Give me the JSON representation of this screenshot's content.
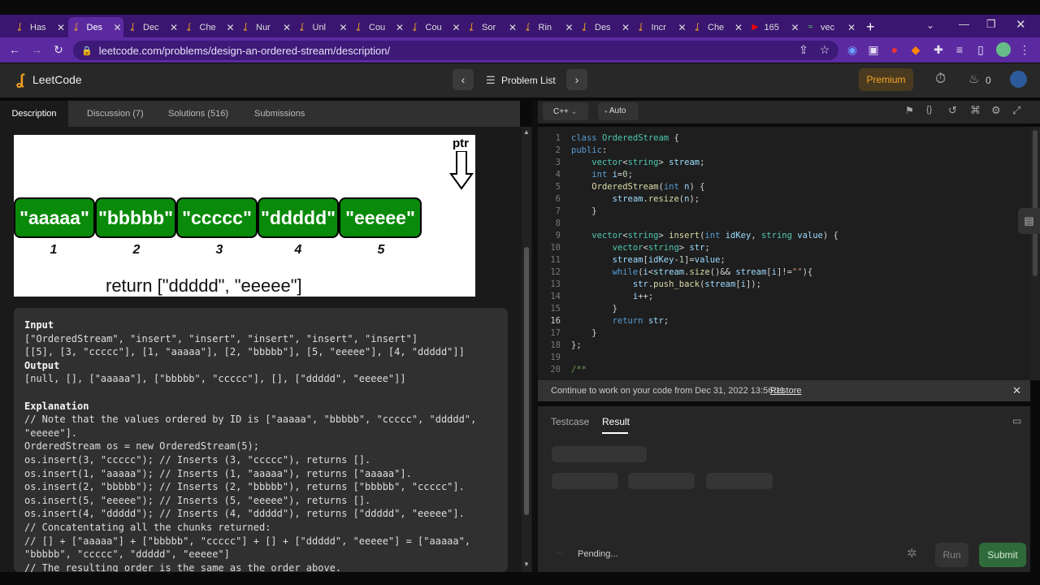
{
  "browser": {
    "tabs": [
      {
        "title": "Has",
        "active": false
      },
      {
        "title": "Des",
        "active": true
      },
      {
        "title": "Dec",
        "active": false
      },
      {
        "title": "Che",
        "active": false
      },
      {
        "title": "Nur",
        "active": false
      },
      {
        "title": "Unl",
        "active": false
      },
      {
        "title": "Cou",
        "active": false
      },
      {
        "title": "Cou",
        "active": false
      },
      {
        "title": "Sor",
        "active": false
      },
      {
        "title": "Rin",
        "active": false
      },
      {
        "title": "Des",
        "active": false
      },
      {
        "title": "Incr",
        "active": false
      },
      {
        "title": "Che",
        "active": false
      },
      {
        "title": "165",
        "active": false
      },
      {
        "title": "vec",
        "active": false
      }
    ],
    "url": "leetcode.com/problems/design-an-ordered-stream/description/"
  },
  "header": {
    "logo": "LeetCode",
    "problem_list": "Problem List",
    "premium": "Premium",
    "streak": "0"
  },
  "left_tabs": [
    "Description",
    "Discussion (7)",
    "Solutions (516)",
    "Submissions"
  ],
  "figure": {
    "ptr": "ptr",
    "blocks": [
      "\"aaaaa\"",
      "\"bbbbb\"",
      "\"ccccc\"",
      "\"ddddd\"",
      "\"eeeee\""
    ],
    "numbers": [
      "1",
      "2",
      "3",
      "4",
      "5"
    ],
    "return_text": "return [\"ddddd\", \"eeeee\"]"
  },
  "example": {
    "input_label": "Input",
    "input_lines": [
      "[\"OrderedStream\", \"insert\", \"insert\", \"insert\", \"insert\", \"insert\"]",
      "[[5], [3, \"ccccc\"], [1, \"aaaaa\"], [2, \"bbbbb\"], [5, \"eeeee\"], [4, \"ddddd\"]]"
    ],
    "output_label": "Output",
    "output_line": "[null, [], [\"aaaaa\"], [\"bbbbb\", \"ccccc\"], [], [\"ddddd\", \"eeeee\"]]",
    "explanation_label": "Explanation",
    "explanation_lines": [
      "// Note that the values ordered by ID is [\"aaaaa\", \"bbbbb\", \"ccccc\", \"ddddd\",",
      "\"eeeee\"].",
      "OrderedStream os = new OrderedStream(5);",
      "os.insert(3, \"ccccc\"); // Inserts (3, \"ccccc\"), returns [].",
      "os.insert(1, \"aaaaa\"); // Inserts (1, \"aaaaa\"), returns [\"aaaaa\"].",
      "os.insert(2, \"bbbbb\"); // Inserts (2, \"bbbbb\"), returns [\"bbbbb\", \"ccccc\"].",
      "os.insert(5, \"eeeee\"); // Inserts (5, \"eeeee\"), returns [].",
      "os.insert(4, \"ddddd\"); // Inserts (4, \"ddddd\"), returns [\"ddddd\", \"eeeee\"].",
      "// Concatentating all the chunks returned:",
      "// [] + [\"aaaaa\"] + [\"bbbbb\", \"ccccc\"] + [] + [\"ddddd\", \"eeeee\"] = [\"aaaaa\",",
      "\"bbbbb\", \"ccccc\", \"ddddd\", \"eeeee\"]",
      "// The resulting order is the same as the order above."
    ]
  },
  "editor": {
    "language": "C++",
    "mode": "Auto",
    "line_numbers": [
      "1",
      "2",
      "3",
      "4",
      "5",
      "6",
      "7",
      "8",
      "9",
      "10",
      "11",
      "12",
      "13",
      "14",
      "15",
      "16",
      "17",
      "18",
      "19",
      "20"
    ]
  },
  "restore_bar": {
    "message": "Continue to work on your code from Dec 31, 2022 13:56:11",
    "restore": "Restore"
  },
  "bottom": {
    "tabs": [
      "Testcase",
      "Result"
    ],
    "status": "Pending...",
    "run": "Run",
    "submit": "Submit"
  }
}
